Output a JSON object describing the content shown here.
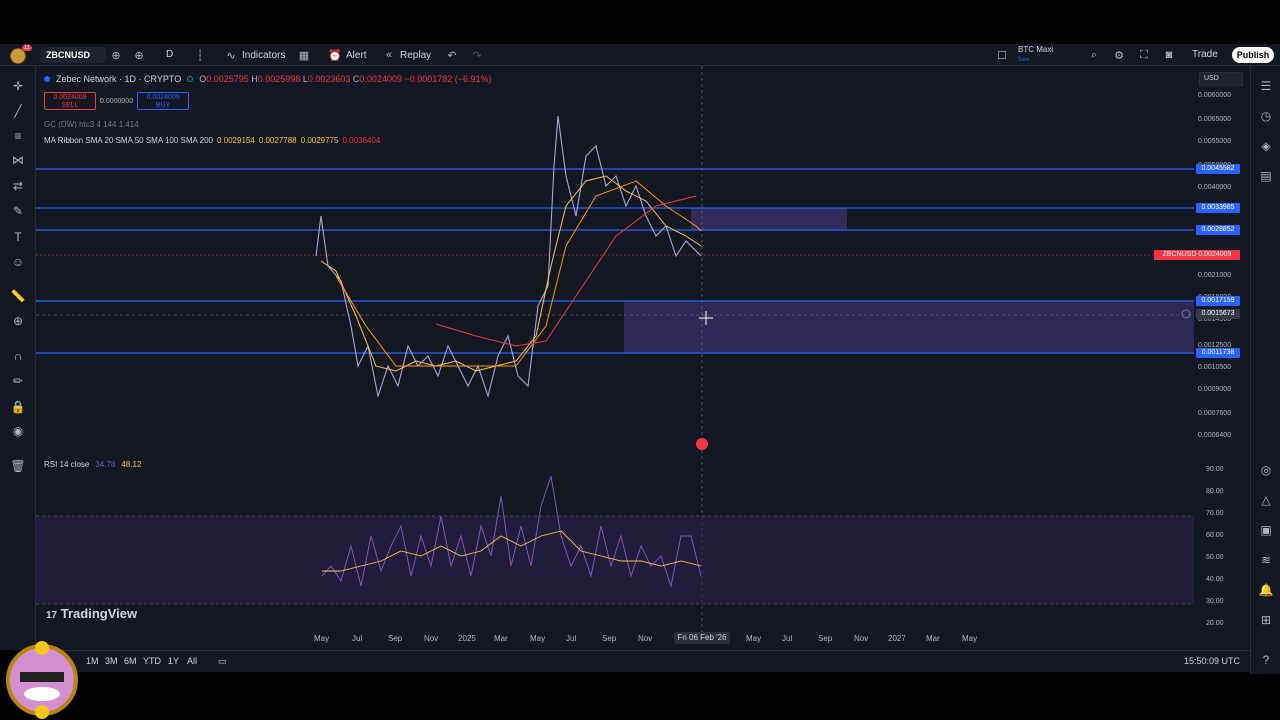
{
  "toolbar": {
    "avatar_badge": "11",
    "symbol": "ZBCNUSD",
    "interval": "D",
    "indicators_label": "Indicators",
    "alert_label": "Alert",
    "replay_label": "Replay",
    "layout_name": "BTC Maxi",
    "layout_sub": "Save",
    "trade_label": "Trade",
    "publish_label": "Publish"
  },
  "legend": {
    "title": "Zebec Network · 1D · CRYPTO",
    "open_label": "O",
    "open": "0.0025795",
    "high_label": "H",
    "high": "0.0025998",
    "low_label": "L",
    "low": "0.0023603",
    "close_label": "C",
    "close": "0.0024009",
    "change": "−0.0001782 (−6.91%)",
    "sell_price": "0.0024009",
    "sell_label": "SELL",
    "spread": "0.0000000",
    "buy_price": "0.0024009",
    "buy_label": "BUY",
    "indicator1": "GC (DW) htc3 4 144 1.414",
    "indicator2_name": "MA Ribbon SMA 20 SMA 50 SMA 100 SMA 200",
    "ma1": "0.0029154",
    "ma2": "0.0027788",
    "ma3": "0.0029775",
    "ma4": "0.0036404",
    "rsi_name": "RSI 14 close",
    "rsi_val1": "34.78",
    "rsi_val2": "48.12"
  },
  "price_axis": {
    "currency": "USD",
    "ticks": [
      "0.0060000",
      "0.0065000",
      "0.0055000",
      "0.0050000",
      "0.0040000",
      "0.0035000",
      "0.0030000",
      "0.0025000",
      "0.0021000",
      "0.0018000",
      "0.0014500",
      "0.0012500",
      "0.0010500",
      "0.0009000",
      "0.0007600",
      "0.0006400"
    ],
    "level_labels": [
      {
        "text": "0.0045582",
        "color": "#2962ff"
      },
      {
        "text": "0.0033985",
        "color": "#2962ff"
      },
      {
        "text": "0.0028852",
        "color": "#2962ff"
      },
      {
        "text": "ZBCNUSD 0.0024009",
        "color": "#f23645"
      },
      {
        "text": "0.0017159",
        "color": "#2962ff"
      },
      {
        "text": "0.0015673",
        "color": "#363a45"
      },
      {
        "text": "0.0011738",
        "color": "#2962ff"
      }
    ],
    "rsi_ticks": [
      "90.00",
      "80.00",
      "70.00",
      "60.00",
      "50.00",
      "40.00",
      "30.00",
      "20.00"
    ]
  },
  "time_axis": {
    "ticks": [
      "May",
      "Jul",
      "Sep",
      "Nov",
      "2025",
      "Mar",
      "May",
      "Jul",
      "Sep",
      "Nov",
      "May",
      "Jul",
      "Sep",
      "Nov",
      "2027",
      "Mar",
      "May"
    ],
    "cursor_date": "Fri 06 Feb '26"
  },
  "bottom": {
    "ranges": [
      "1M",
      "3M",
      "6M",
      "YTD",
      "1Y",
      "All"
    ],
    "clock": "15:50:09 UTC"
  },
  "branding": {
    "logo_text": "TradingView"
  },
  "colors": {
    "bg": "#131722",
    "accent": "#2962ff",
    "down": "#f23645",
    "zone": "#7e57c2"
  }
}
